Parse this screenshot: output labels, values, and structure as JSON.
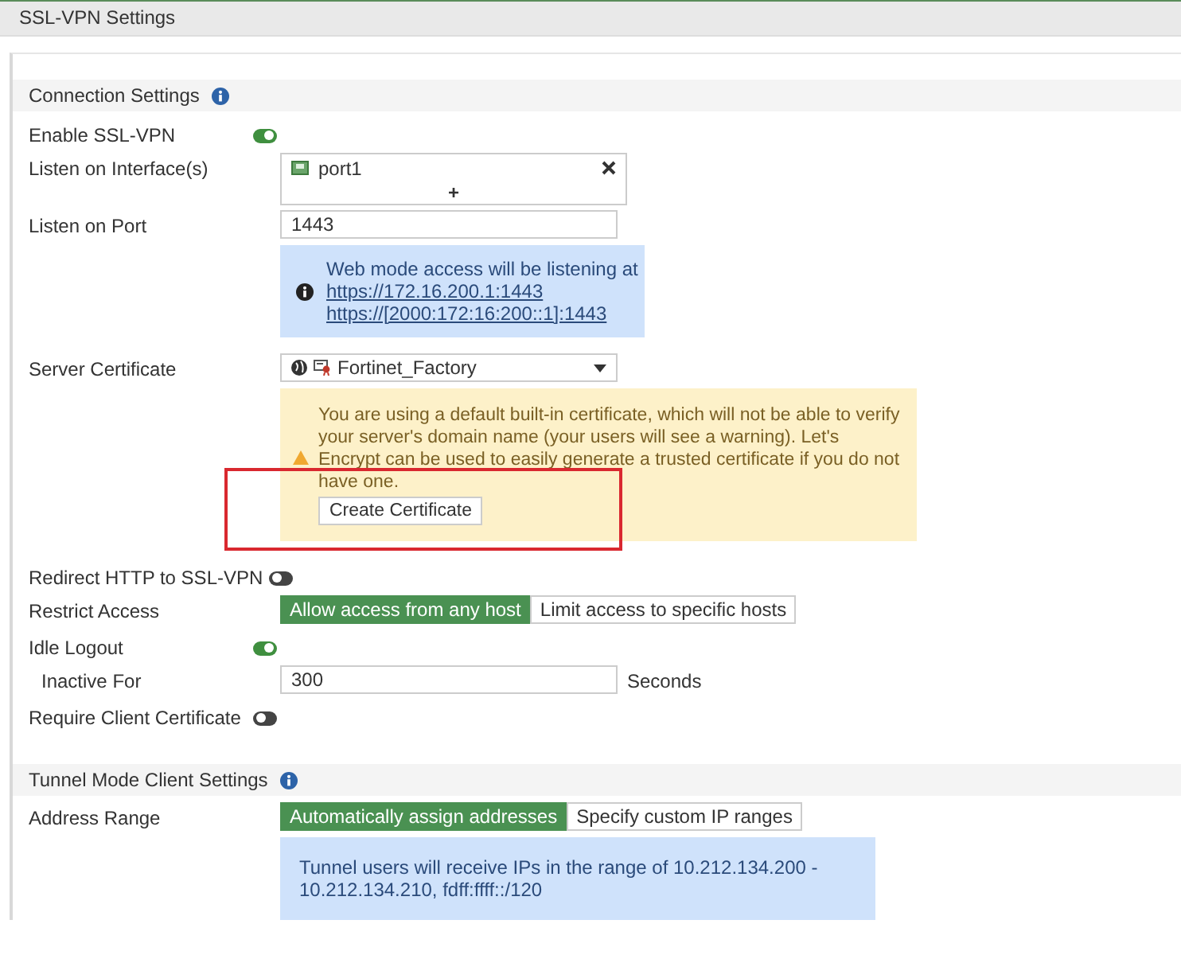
{
  "window": {
    "title": "SSL-VPN Settings"
  },
  "sections": [
    {
      "title": "Connection Settings",
      "rows": [
        {
          "kind": "toggle",
          "label": "Enable SSL-VPN",
          "on": true
        },
        {
          "kind": "interfaces",
          "label": "Listen on Interface(s)",
          "items": [
            "port1"
          ],
          "add": "+"
        },
        {
          "kind": "input",
          "label": "Listen on Port",
          "value": "1443"
        },
        {
          "kind": "info",
          "lines": [
            "Web mode access will be listening at"
          ],
          "links": [
            "https://172.16.200.1:1443",
            "https://[2000:172:16:200::1]:1443"
          ]
        },
        {
          "kind": "select",
          "label": "Server Certificate",
          "value": "Fortinet_Factory"
        },
        {
          "kind": "warning",
          "text": "You are using a default built-in certificate, which will not be able to verify your server's domain name (your users will see a warning). Let's Encrypt can be used to easily generate a trusted certificate if you do not have one.",
          "button": "Create Certificate",
          "highlighted": true
        },
        {
          "kind": "toggle",
          "label": "Redirect HTTP to SSL-VPN",
          "on": false
        },
        {
          "kind": "segmented",
          "label": "Restrict Access",
          "options": [
            {
              "label": "Allow access from any host",
              "selected": true
            },
            {
              "label": "Limit access to specific hosts",
              "selected": false
            }
          ]
        },
        {
          "kind": "toggle",
          "label": "Idle Logout",
          "on": true
        },
        {
          "kind": "input",
          "label": "Inactive For",
          "value": "300",
          "suffix": "Seconds",
          "indented": true
        },
        {
          "kind": "toggle",
          "label": "Require Client Certificate",
          "on": false
        }
      ]
    },
    {
      "title": "Tunnel Mode Client Settings",
      "rows": [
        {
          "kind": "segmented",
          "label": "Address Range",
          "options": [
            {
              "label": "Automatically assign addresses",
              "selected": true
            },
            {
              "label": "Specify custom IP ranges",
              "selected": false
            }
          ]
        },
        {
          "kind": "info",
          "lines": [
            "Tunnel users will receive IPs in the range of 10.212.134.200 - 10.212.134.210, fdff:ffff::/120"
          ],
          "links": [],
          "plain": true
        }
      ]
    }
  ]
}
